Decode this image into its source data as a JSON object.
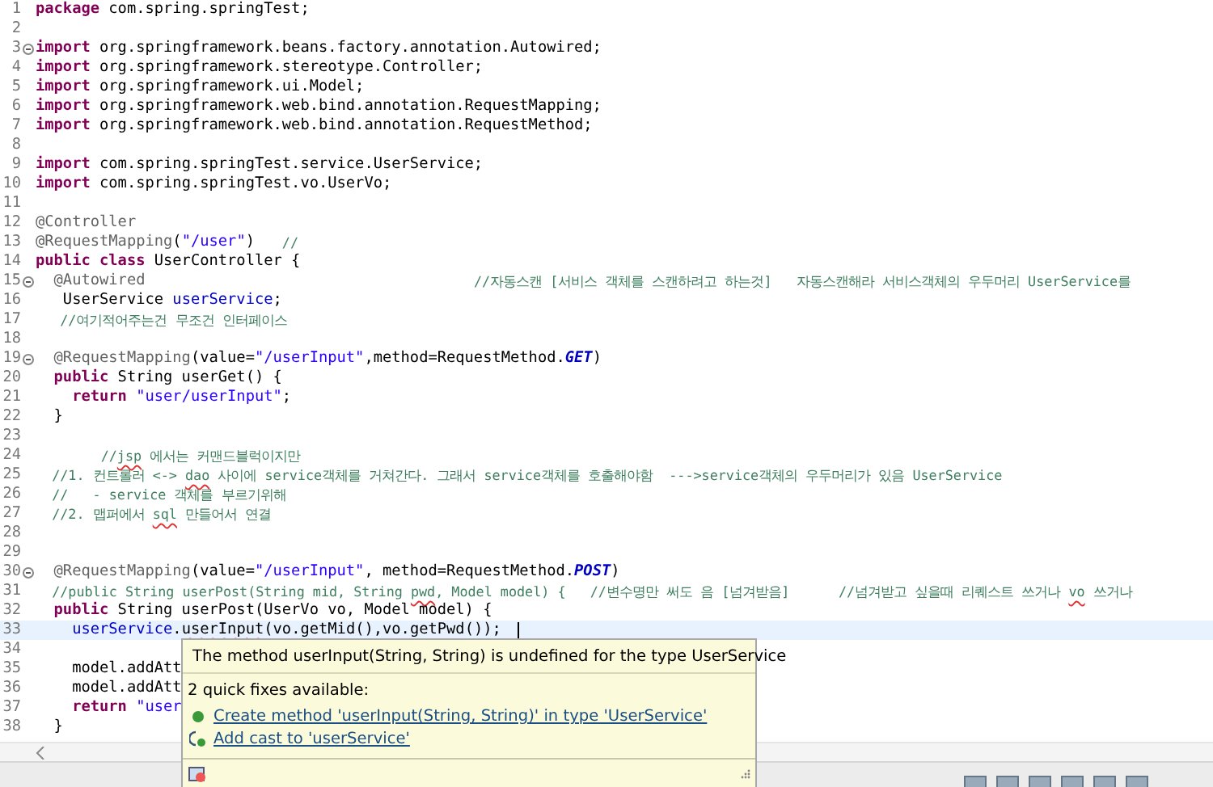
{
  "editor": {
    "lines": [
      {
        "number": "1",
        "fold": false,
        "current": false,
        "tokens": [
          {
            "kind": "kw",
            "text": "package"
          },
          {
            "kind": "plain",
            "text": " com.spring.springTest;"
          }
        ]
      },
      {
        "number": "2",
        "fold": false,
        "current": false
      },
      {
        "number": "3",
        "fold": true,
        "current": false,
        "tokens": [
          {
            "kind": "kw",
            "text": "import"
          },
          {
            "kind": "plain",
            "text": " org.springframework.beans.factory.annotation.Autowired;"
          }
        ]
      },
      {
        "number": "4",
        "fold": false,
        "current": false,
        "tokens": [
          {
            "kind": "kw",
            "text": "import"
          },
          {
            "kind": "plain",
            "text": " org.springframework.stereotype.Controller;"
          }
        ]
      },
      {
        "number": "5",
        "fold": false,
        "current": false,
        "tokens": [
          {
            "kind": "kw",
            "text": "import"
          },
          {
            "kind": "plain",
            "text": " org.springframework.ui.Model;"
          }
        ]
      },
      {
        "number": "6",
        "fold": false,
        "current": false,
        "tokens": [
          {
            "kind": "kw",
            "text": "import"
          },
          {
            "kind": "plain",
            "text": " org.springframework.web.bind.annotation.RequestMapping;"
          }
        ]
      },
      {
        "number": "7",
        "fold": false,
        "current": false,
        "tokens": [
          {
            "kind": "kw",
            "text": "import"
          },
          {
            "kind": "plain",
            "text": " org.springframework.web.bind.annotation.RequestMethod;"
          }
        ]
      },
      {
        "number": "8",
        "fold": false,
        "current": false
      },
      {
        "number": "9",
        "fold": false,
        "current": false,
        "tokens": [
          {
            "kind": "kw",
            "text": "import"
          },
          {
            "kind": "plain",
            "text": " com.spring.springTest.service.UserService;"
          }
        ]
      },
      {
        "number": "10",
        "fold": false,
        "current": false,
        "tokens": [
          {
            "kind": "kw",
            "text": "import"
          },
          {
            "kind": "plain",
            "text": " com.spring.springTest.vo.UserVo;"
          }
        ]
      },
      {
        "number": "11",
        "fold": false,
        "current": false
      },
      {
        "number": "12",
        "fold": false,
        "current": false,
        "tokens": [
          {
            "kind": "ann",
            "text": "@Controller"
          }
        ]
      },
      {
        "number": "13",
        "fold": false,
        "current": false,
        "tokens": [
          {
            "kind": "ann",
            "text": "@RequestMapping"
          },
          {
            "kind": "plain",
            "text": "("
          },
          {
            "kind": "str",
            "text": "\"/user\""
          },
          {
            "kind": "plain",
            "text": ")   "
          },
          {
            "kind": "com",
            "text": "//"
          }
        ]
      },
      {
        "number": "14",
        "fold": false,
        "current": false,
        "tokens": [
          {
            "kind": "kw",
            "text": "public class"
          },
          {
            "kind": "plain",
            "text": " UserController {"
          }
        ]
      },
      {
        "number": "15",
        "fold": true,
        "current": false,
        "tokens": [
          {
            "kind": "ann",
            "text": "  @Autowired                                    "
          },
          {
            "kind": "com",
            "text": "//자동스캔 [서비스 객체를 스캔하려고 하는것]   자동스캔해라 서비스객체의 우두머리 UserService를"
          }
        ]
      },
      {
        "number": "16",
        "fold": false,
        "current": false,
        "tokens": [
          {
            "kind": "plain",
            "text": "   UserService "
          },
          {
            "kind": "fld",
            "text": "userService"
          },
          {
            "kind": "plain",
            "text": ";"
          }
        ]
      },
      {
        "number": "17",
        "fold": false,
        "current": false,
        "tokens": [
          {
            "kind": "com",
            "text": "   //여기적어주는건 무조건 인터페이스"
          }
        ]
      },
      {
        "number": "18",
        "fold": false,
        "current": false
      },
      {
        "number": "19",
        "fold": true,
        "current": false,
        "tokens": [
          {
            "kind": "ann",
            "text": "  @RequestMapping"
          },
          {
            "kind": "plain",
            "text": "(value="
          },
          {
            "kind": "str",
            "text": "\"/userInput\""
          },
          {
            "kind": "plain",
            "text": ",method=RequestMethod."
          },
          {
            "kind": "const",
            "text": "GET"
          },
          {
            "kind": "plain",
            "text": ")"
          }
        ]
      },
      {
        "number": "20",
        "fold": false,
        "current": false,
        "tokens": [
          {
            "kind": "kw",
            "text": "  public"
          },
          {
            "kind": "plain",
            "text": " String userGet() {"
          }
        ]
      },
      {
        "number": "21",
        "fold": false,
        "current": false,
        "tokens": [
          {
            "kind": "kw",
            "text": "    return "
          },
          {
            "kind": "str",
            "text": "\"user/userInput\""
          },
          {
            "kind": "plain",
            "text": ";"
          }
        ]
      },
      {
        "number": "22",
        "fold": false,
        "current": false,
        "tokens": [
          {
            "kind": "plain",
            "text": "  }"
          }
        ]
      },
      {
        "number": "23",
        "fold": false,
        "current": false
      },
      {
        "number": "24",
        "fold": false,
        "current": false,
        "tokens": [
          {
            "kind": "com",
            "text": "        //"
          },
          {
            "kind": "com",
            "text": "jsp",
            "error": true
          },
          {
            "kind": "com",
            "text": " 에서는 커맨드블럭이지만"
          }
        ]
      },
      {
        "number": "25",
        "fold": false,
        "current": false,
        "tokens": [
          {
            "kind": "com",
            "text": "  //1. 컨트롤러 <-> "
          },
          {
            "kind": "com",
            "text": "dao",
            "error": true
          },
          {
            "kind": "com",
            "text": " 사이에 service객체를 거쳐간다. 그래서 service객체를 호출해야함  --->service객체의 우두머리가 있음 UserService"
          }
        ]
      },
      {
        "number": "26",
        "fold": false,
        "current": false,
        "tokens": [
          {
            "kind": "com",
            "text": "  //   - service 객체를 부르기위해"
          }
        ]
      },
      {
        "number": "27",
        "fold": false,
        "current": false,
        "tokens": [
          {
            "kind": "com",
            "text": "  //2. 맵퍼에서 "
          },
          {
            "kind": "com",
            "text": "sql",
            "error": true
          },
          {
            "kind": "com",
            "text": " 만들어서 연결"
          }
        ]
      },
      {
        "number": "28",
        "fold": false,
        "current": false
      },
      {
        "number": "29",
        "fold": false,
        "current": false
      },
      {
        "number": "30",
        "fold": true,
        "current": false,
        "tokens": [
          {
            "kind": "ann",
            "text": "  @RequestMapping"
          },
          {
            "kind": "plain",
            "text": "(value="
          },
          {
            "kind": "str",
            "text": "\"/userInput\""
          },
          {
            "kind": "plain",
            "text": ", method=RequestMethod."
          },
          {
            "kind": "const",
            "text": "POST"
          },
          {
            "kind": "plain",
            "text": ")"
          }
        ]
      },
      {
        "number": "31",
        "fold": false,
        "current": false,
        "tokens": [
          {
            "kind": "com",
            "text": "  //public String userPost(String mid, String "
          },
          {
            "kind": "com",
            "text": "pwd",
            "error": true
          },
          {
            "kind": "com",
            "text": ", Model model) {   //변수명만 써도 음 [넘겨받음]      //넘겨받고 싶을때 리퀘스트 쓰거나 "
          },
          {
            "kind": "com",
            "text": "vo",
            "error": true
          },
          {
            "kind": "com",
            "text": " 쓰거나"
          }
        ]
      },
      {
        "number": "32",
        "fold": false,
        "current": false,
        "tokens": [
          {
            "kind": "kw",
            "text": "  public"
          },
          {
            "kind": "plain",
            "text": " String userPost(UserVo vo, Model model) {"
          }
        ]
      },
      {
        "number": "33",
        "fold": false,
        "current": true,
        "tokens": [
          {
            "kind": "fld",
            "text": "    userService"
          },
          {
            "kind": "plain",
            "text": "."
          },
          {
            "kind": "plain",
            "text": "userInput",
            "error": true
          },
          {
            "kind": "plain",
            "text": "(vo.getMid(),vo.getPwd());"
          }
        ]
      },
      {
        "number": "34",
        "fold": false,
        "current": false
      },
      {
        "number": "35",
        "fold": false,
        "current": false,
        "tokens": [
          {
            "kind": "plain",
            "text": "    model.addAtt"
          }
        ]
      },
      {
        "number": "36",
        "fold": false,
        "current": false,
        "tokens": [
          {
            "kind": "plain",
            "text": "    model.addAtt"
          }
        ]
      },
      {
        "number": "37",
        "fold": false,
        "current": false,
        "tokens": [
          {
            "kind": "kw",
            "text": "    return "
          },
          {
            "kind": "str",
            "text": "\"user"
          }
        ]
      },
      {
        "number": "38",
        "fold": false,
        "current": false,
        "tokens": [
          {
            "kind": "plain",
            "text": "  }"
          }
        ]
      }
    ]
  },
  "quick_fix_popup": {
    "message": "The method userInput(String, String) is undefined for the type UserService",
    "summary": "2 quick fixes available:",
    "fixes": [
      {
        "kind": "create",
        "label": "Create method 'userInput(String, String)' in type 'UserService'"
      },
      {
        "kind": "cast",
        "label": "Add cast to 'userService'"
      }
    ]
  }
}
